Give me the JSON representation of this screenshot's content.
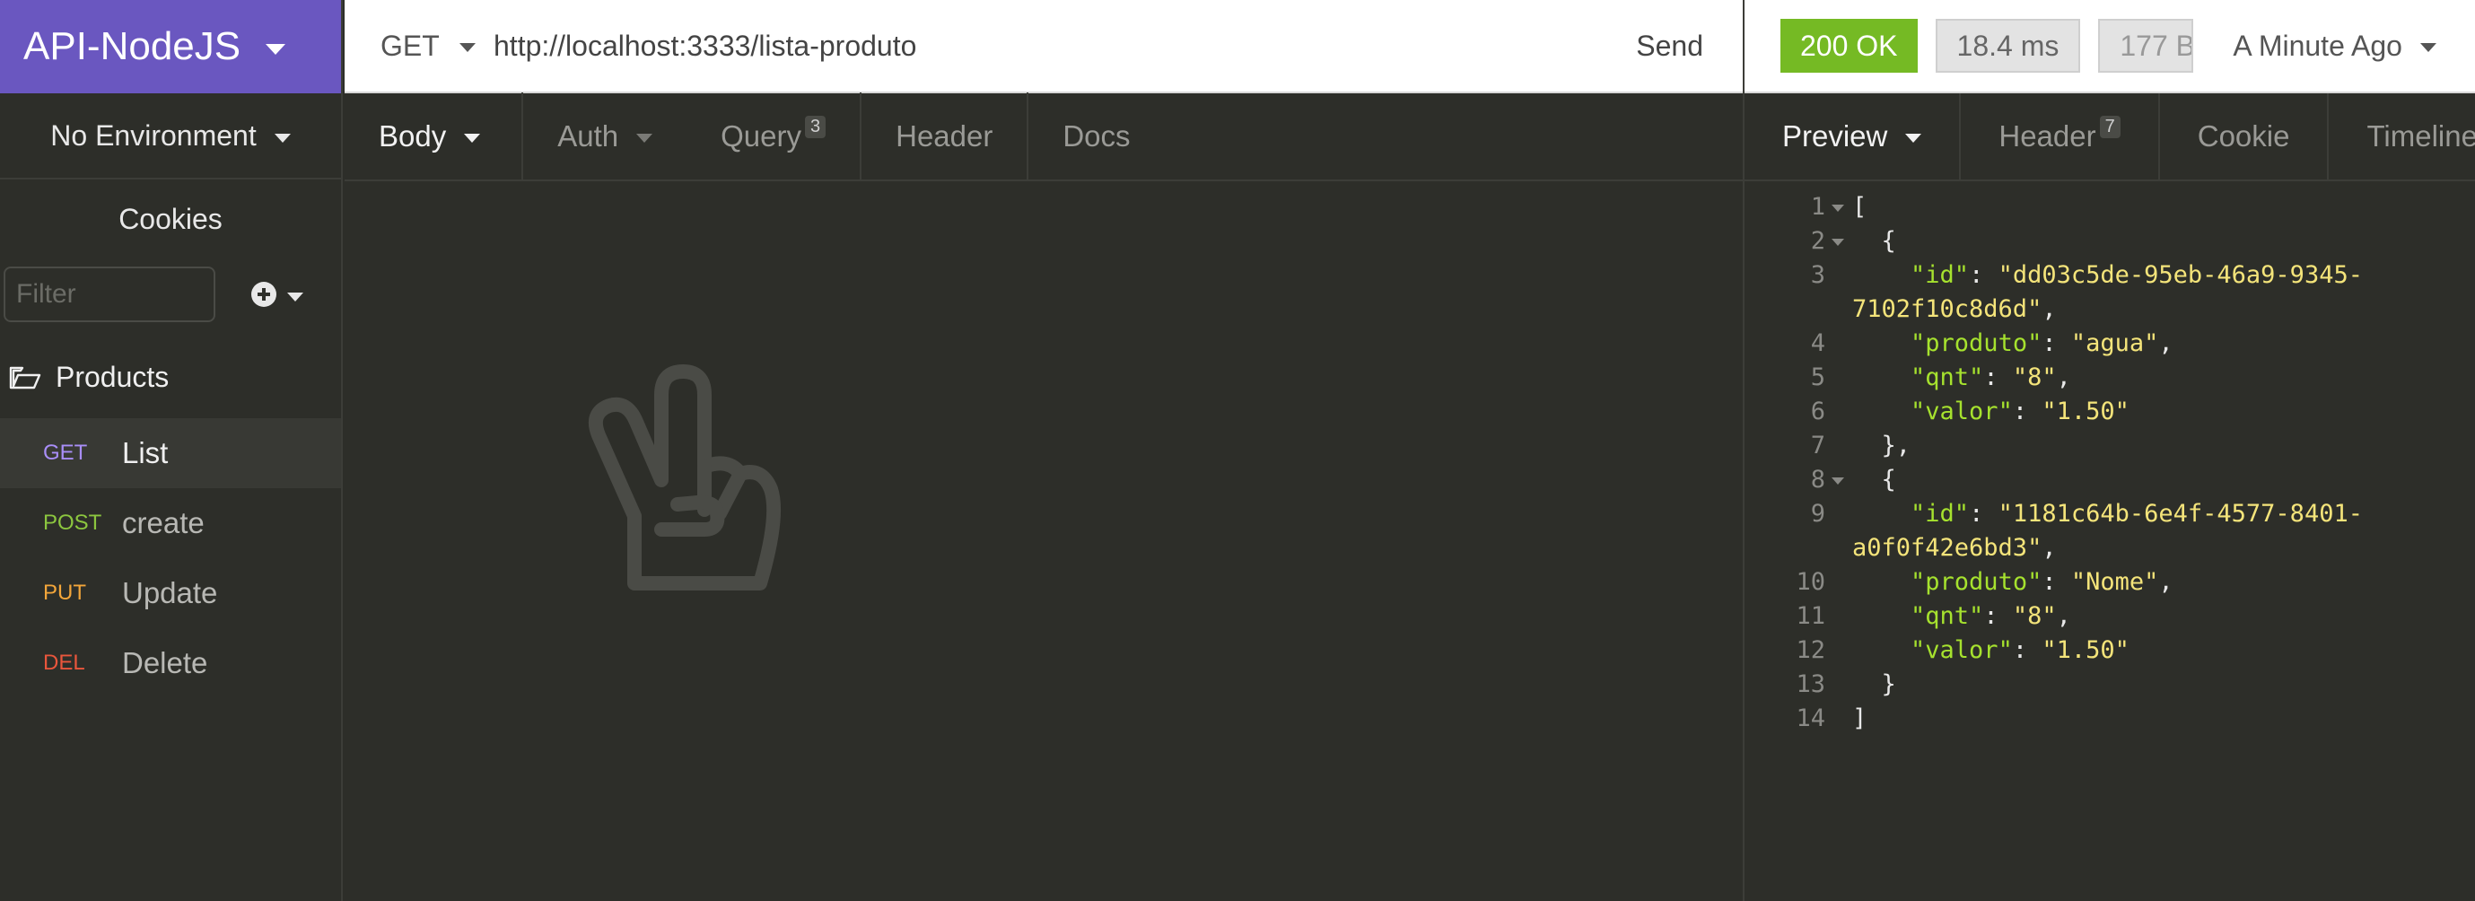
{
  "sidebar": {
    "workspace": "API-NodeJS",
    "environment": "No Environment",
    "cookies": "Cookies",
    "filter_placeholder": "Filter",
    "folder": "Products",
    "requests": [
      {
        "method": "GET",
        "name": "List",
        "color": "#a98ef8",
        "active": true
      },
      {
        "method": "POST",
        "name": "create",
        "color": "#8cc63f"
      },
      {
        "method": "PUT",
        "name": "Update",
        "color": "#f3a63a"
      },
      {
        "method": "DEL",
        "name": "Delete",
        "color": "#e9563c"
      }
    ]
  },
  "request": {
    "method": "GET",
    "url": "http://localhost:3333/lista-produto",
    "send_label": "Send",
    "tabs": {
      "body": "Body",
      "auth": "Auth",
      "query": "Query",
      "query_count": "3",
      "header": "Header",
      "docs": "Docs"
    }
  },
  "response": {
    "status": "200 OK",
    "time": "18.4 ms",
    "size": "177 B",
    "when": "A Minute Ago",
    "tabs": {
      "preview": "Preview",
      "header": "Header",
      "header_count": "7",
      "cookie": "Cookie",
      "timeline": "Timeline"
    },
    "lines": {
      "l1": "[",
      "l2": "  {",
      "l3_key": "\"id\"",
      "l3_val": "\"dd03c5de-95eb-46a9-9345-7102f10c8d6d\"",
      "l4_key": "\"produto\"",
      "l4_val": "\"agua\"",
      "l5_key": "\"qnt\"",
      "l5_val": "\"8\"",
      "l6_key": "\"valor\"",
      "l6_val": "\"1.50\"",
      "l7": "  },",
      "l8": "  {",
      "l9_key": "\"id\"",
      "l9_val": "\"1181c64b-6e4f-4577-8401-a0f0f42e6bd3\"",
      "l10_key": "\"produto\"",
      "l10_val": "\"Nome\"",
      "l11_key": "\"qnt\"",
      "l11_val": "\"8\"",
      "l12_key": "\"valor\"",
      "l12_val": "\"1.50\"",
      "l13": "  }",
      "l14": "]"
    },
    "line_numbers": [
      "1",
      "2",
      "3",
      "4",
      "5",
      "6",
      "7",
      "8",
      "9",
      "10",
      "11",
      "12",
      "13",
      "14"
    ]
  },
  "icons": {
    "workspace_caret": "chevron-down-icon",
    "folder": "folder-open-icon",
    "add": "plus-circle-icon",
    "empty_state": "peace-hand-icon"
  }
}
